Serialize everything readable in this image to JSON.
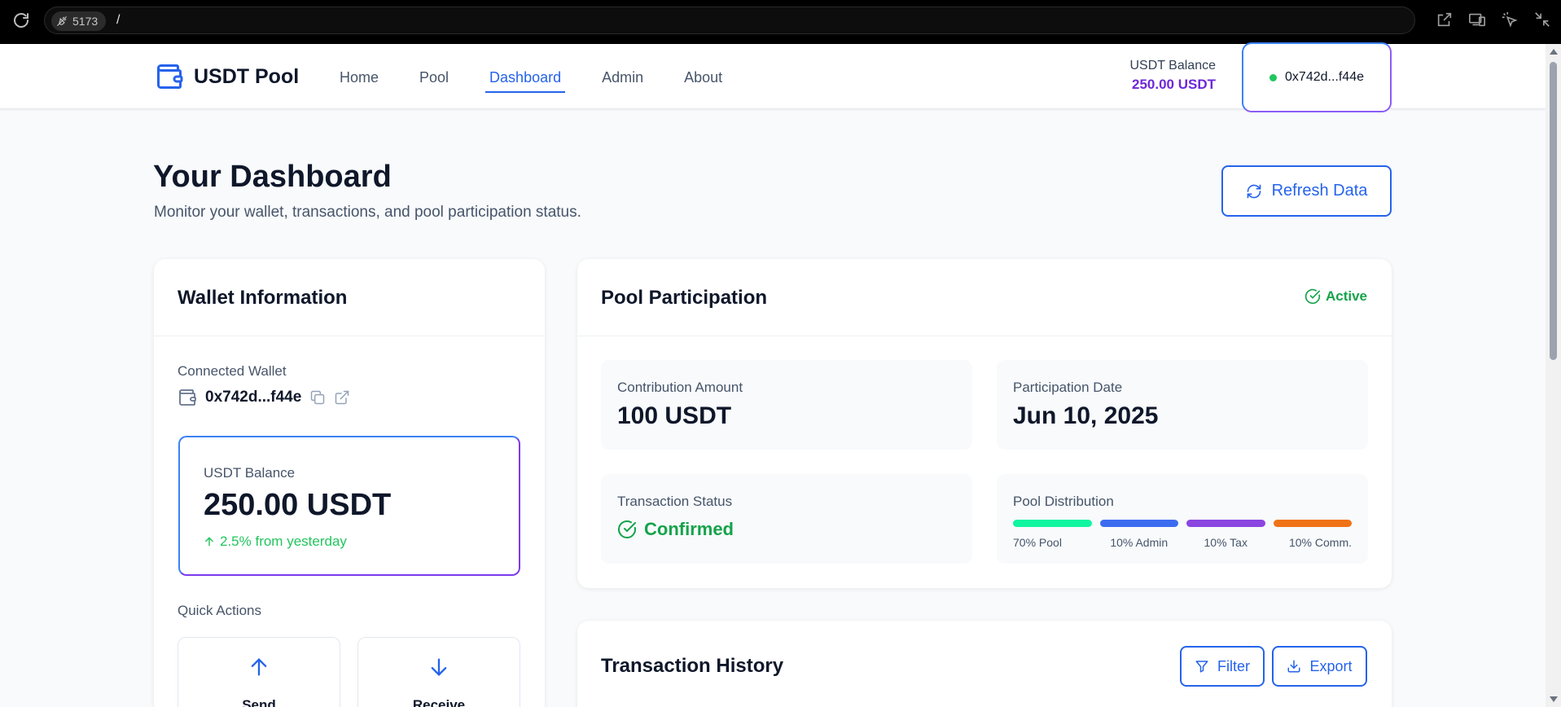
{
  "browser": {
    "port": "5173",
    "path": "/"
  },
  "header": {
    "brand": "USDT Pool",
    "nav": [
      {
        "label": "Home"
      },
      {
        "label": "Pool"
      },
      {
        "label": "Dashboard",
        "active": true
      },
      {
        "label": "Admin"
      },
      {
        "label": "About"
      }
    ],
    "balance_label": "USDT Balance",
    "balance_value": "250.00 USDT",
    "wallet_address": "0x742d...f44e"
  },
  "page": {
    "title": "Your Dashboard",
    "subtitle": "Monitor your wallet, transactions, and pool participation status.",
    "refresh_label": "Refresh Data"
  },
  "wallet_card": {
    "title": "Wallet Information",
    "connected_label": "Connected Wallet",
    "address": "0x742d...f44e",
    "balance_label": "USDT Balance",
    "balance_value": "250.00 USDT",
    "change": "2.5% from yesterday",
    "quick_actions_label": "Quick Actions",
    "send_label": "Send",
    "receive_label": "Receive"
  },
  "pool_card": {
    "title": "Pool Participation",
    "status_badge": "Active",
    "contribution_label": "Contribution Amount",
    "contribution_value": "100 USDT",
    "date_label": "Participation Date",
    "date_value": "Jun 10, 2025",
    "tx_status_label": "Transaction Status",
    "tx_status_value": "Confirmed",
    "distribution_label": "Pool Distribution",
    "distribution": [
      {
        "label": "70% Pool",
        "color": "#10f5a0"
      },
      {
        "label": "10% Admin",
        "color": "#3b6cf0"
      },
      {
        "label": "10% Tax",
        "color": "#8b45e0"
      },
      {
        "label": "10% Comm.",
        "color": "#f07318"
      }
    ]
  },
  "tx_card": {
    "title": "Transaction History",
    "filter_label": "Filter",
    "export_label": "Export"
  },
  "colors": {
    "accent": "#2563eb",
    "brand_purple": "#6d28d9",
    "success": "#16a34a"
  },
  "icons": [
    "reload-icon",
    "plug-off-icon",
    "open-external-icon",
    "devices-icon",
    "cursor-click-icon",
    "minimize-icon",
    "wallet-icon",
    "refresh-icon",
    "copy-icon",
    "external-link-icon",
    "arrow-up-icon",
    "arrow-down-icon",
    "check-circle-icon",
    "filter-icon",
    "download-icon"
  ]
}
